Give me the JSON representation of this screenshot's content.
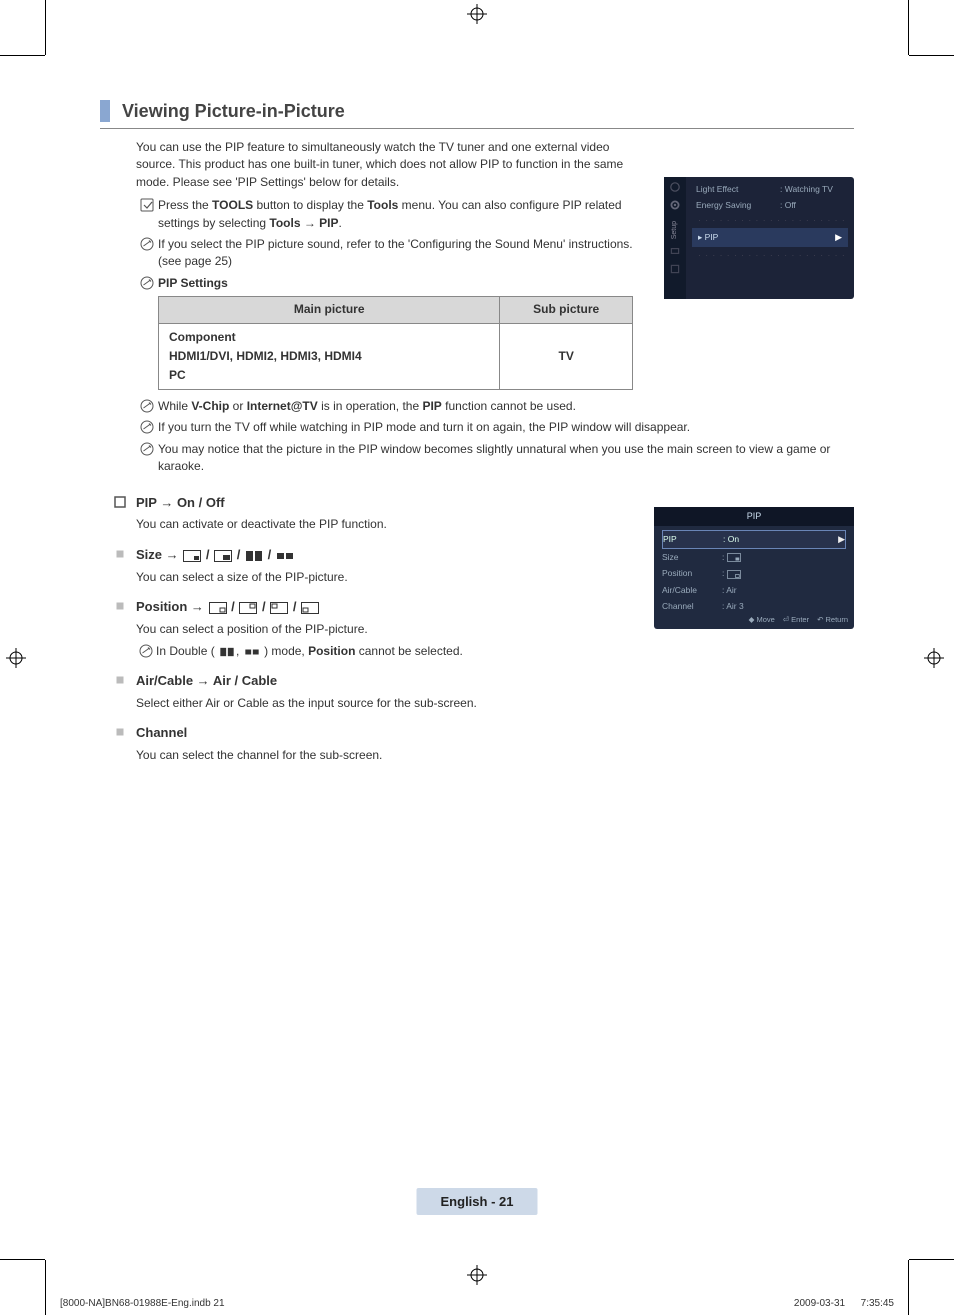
{
  "section": {
    "title": "Viewing Picture-in-Picture"
  },
  "intro": "You can use the PIP feature to simultaneously watch the TV tuner and one external video source. This product has one built-in tuner, which does not allow PIP to function in the same mode. Please see 'PIP Settings' below for details.",
  "notes": {
    "tools_pre": "Press the ",
    "tools_bold1": "TOOLS",
    "tools_mid1": " button to display the ",
    "tools_bold2": "Tools",
    "tools_mid2": " menu. You can also configure PIP related settings by selecting ",
    "tools_bold3": "Tools → PIP",
    "tools_end": ".",
    "sound": "If you select the PIP picture sound, refer to the 'Configuring the Sound Menu' instructions. (see page 25)",
    "settings_label": "PIP Settings"
  },
  "pip_table": {
    "head_main": "Main picture",
    "head_sub": "Sub picture",
    "main_list": "Component\nHDMI1/DVI, HDMI2, HDMI3, HDMI4\nPC",
    "sub_value": "TV"
  },
  "warnings": {
    "vchip_pre": "While ",
    "vchip_b1": "V-Chip",
    "vchip_mid": " or ",
    "vchip_b2": "Internet@TV",
    "vchip_mid2": " is in operation, the ",
    "vchip_b3": "PIP",
    "vchip_end": " function cannot be used.",
    "off": "If you turn the TV off while watching in PIP mode and turn it on again, the PIP window will disappear.",
    "unnat": "You may notice that the picture in the PIP window becomes slightly unnatural when you use the main screen to view a game or karaoke."
  },
  "items": {
    "pip_label": "PIP → On / Off",
    "pip_desc": "You can activate or deactivate the PIP function.",
    "size_label": "Size → ",
    "size_desc": "You can select a size of the PIP-picture.",
    "pos_label": "Position → ",
    "pos_desc": "You can select a position of the PIP-picture.",
    "pos_note_pre": "In Double (",
    "pos_note_mid": ", ",
    "pos_note_post": ") mode, ",
    "pos_note_bold": "Position",
    "pos_note_end": " cannot be selected.",
    "air_label": "Air/Cable → Air / Cable",
    "air_desc": "Select either Air or Cable as the input source for the sub-screen.",
    "ch_label": "Channel",
    "ch_desc": "You can select the channel for the sub-screen."
  },
  "osd1": {
    "sidebar_label": "Setup",
    "r1_lab": "Light Effect",
    "r1_val": "Watching TV",
    "r2_lab": "Energy Saving",
    "r2_val": "Off",
    "hl": "PIP"
  },
  "osd2": {
    "title": "PIP",
    "rows": [
      {
        "lab": "PIP",
        "val": "On",
        "sel": true,
        "arrow": true
      },
      {
        "lab": "Size",
        "val": "",
        "sel": false,
        "icon": "size-br"
      },
      {
        "lab": "Position",
        "val": "",
        "sel": false,
        "icon": "pos-br"
      },
      {
        "lab": "Air/Cable",
        "val": "Air",
        "sel": false
      },
      {
        "lab": "Channel",
        "val": "Air 3",
        "sel": false
      }
    ],
    "footer": {
      "move": "Move",
      "enter": "Enter",
      "ret": "Return"
    }
  },
  "footer_label": "English - 21",
  "print": {
    "left": "[8000-NA]BN68-01988E-Eng.indb   21",
    "right": "2009-03-31      7:35:45"
  }
}
